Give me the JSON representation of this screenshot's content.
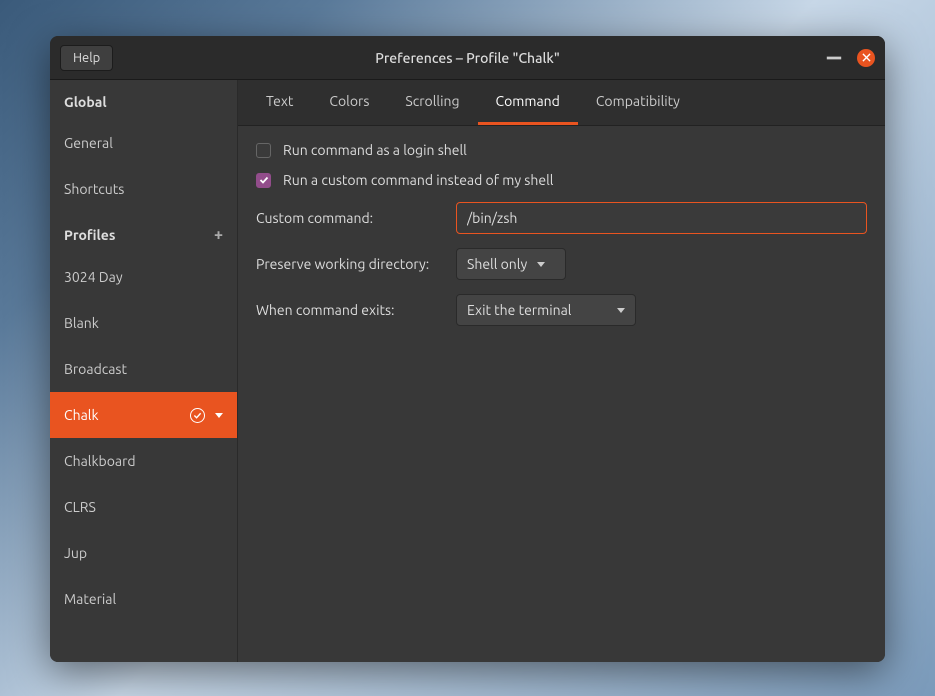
{
  "window": {
    "title": "Preferences – Profile \"Chalk\"",
    "help_label": "Help"
  },
  "sidebar": {
    "global_label": "Global",
    "global_items": [
      "General",
      "Shortcuts"
    ],
    "profiles_label": "Profiles",
    "profiles": [
      "3024 Day",
      "Blank",
      "Broadcast",
      "Chalk",
      "Chalkboard",
      "CLRS",
      "Jup",
      "Material"
    ],
    "selected_profile": "Chalk"
  },
  "tabs": {
    "items": [
      "Text",
      "Colors",
      "Scrolling",
      "Command",
      "Compatibility"
    ],
    "active": "Command"
  },
  "command_pane": {
    "login_shell_label": "Run command as a login shell",
    "login_shell_checked": false,
    "custom_command_checkbox_label": "Run a custom command instead of my shell",
    "custom_command_checked": true,
    "custom_command_label": "Custom command:",
    "custom_command_value": "/bin/zsh",
    "preserve_dir_label": "Preserve working directory:",
    "preserve_dir_value": "Shell only",
    "when_exit_label": "When command exits:",
    "when_exit_value": "Exit the terminal"
  }
}
